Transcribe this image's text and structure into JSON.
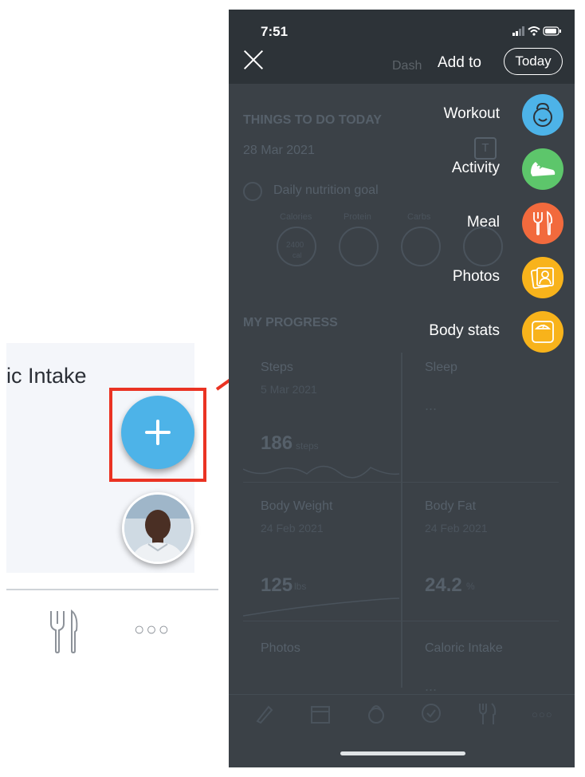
{
  "left_panel": {
    "title": "ic Intake",
    "more_glyph": "○○○"
  },
  "phone": {
    "status": {
      "time": "7:51"
    },
    "header": {
      "dash_label": "Dash",
      "add_to_label": "Add to",
      "today_label": "Today"
    },
    "background": {
      "things_title": "THINGS TO DO TODAY",
      "date": "28 Mar 2021",
      "t_badge": "T",
      "nutrition_goal": "Daily nutrition goal",
      "macro_labels": [
        "Calories",
        "Protein",
        "Carbs"
      ],
      "calorie_value": "2400",
      "calorie_unit": "cal",
      "progress_title": "MY PROGRESS",
      "steps_label": "Steps",
      "steps_date": "5 Mar 2021",
      "steps_value": "186",
      "steps_unit": "steps",
      "sleep_label": "Sleep",
      "sleep_value": "...",
      "weight_label": "Body Weight",
      "weight_date": "24 Feb 2021",
      "weight_value": "125",
      "weight_unit": "lbs",
      "fat_label": "Body Fat",
      "fat_date": "24 Feb 2021",
      "fat_value": "24.2",
      "fat_unit": "%",
      "photos_label": "Photos",
      "caloric_label": "Caloric Intake",
      "caloric_value": "...",
      "nav_more": "○○○"
    },
    "menu": [
      {
        "label": "Workout",
        "icon": "kettlebell-icon",
        "color": "#4db3e8"
      },
      {
        "label": "Activity",
        "icon": "sneaker-icon",
        "color": "#5dc66b"
      },
      {
        "label": "Meal",
        "icon": "fork-knife-icon",
        "color": "#f26a3d"
      },
      {
        "label": "Photos",
        "icon": "photos-icon",
        "color": "#f8b31b"
      },
      {
        "label": "Body stats",
        "icon": "scale-icon",
        "color": "#f8b31b"
      }
    ]
  },
  "colors": {
    "accent_blue": "#4db3e8",
    "annotation_red": "#ea3323",
    "overlay_dark": "#3b4147"
  }
}
